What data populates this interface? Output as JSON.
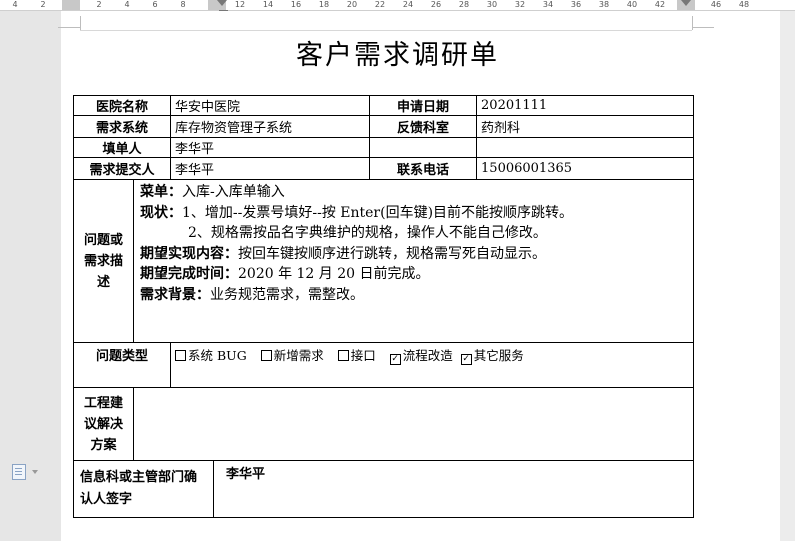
{
  "ruler": {
    "numbers": [
      "4",
      "2",
      "2",
      "4",
      "6",
      "8",
      "12",
      "14",
      "16",
      "18",
      "20",
      "22",
      "24",
      "26",
      "28",
      "30",
      "32",
      "34",
      "36",
      "38",
      "40",
      "42",
      "46",
      "48"
    ]
  },
  "document": {
    "title": "客户需求调研单",
    "rows": {
      "hospital_label": "医院名称",
      "hospital_value": "华安中医院",
      "apply_date_label": "申请日期",
      "apply_date_value": "20201111",
      "system_label": "需求系统",
      "system_value": "库存物资管理子系统",
      "dept_label": "反馈科室",
      "dept_value": "药剂科",
      "filler_label": "填单人",
      "filler_value": "李华平",
      "submitter_label": "需求提交人",
      "submitter_value": "李华平",
      "phone_label": "联系电话",
      "phone_value": "15006001365"
    },
    "problem": {
      "label": "问题或需求描述",
      "menu_label": "菜单：",
      "menu_value": "入库-入库单输入",
      "status_label": "现状：",
      "status_1": "1、增加--发票号填好--按 Enter(回车键)目前不能按顺序跳转。",
      "status_2": "2、规格需按品名字典维护的规格，操作人不能自己修改。",
      "expect_label": "期望实现内容：",
      "expect_value": "按回车键按顺序进行跳转，规格需写死自动显示。",
      "deadline_label": "期望完成时间：",
      "deadline_value": "2020 年 12 月 20 日前完成。",
      "background_label": "需求背景：",
      "background_value": "业务规范需求，需整改。"
    },
    "problem_type": {
      "label": "问题类型",
      "options": [
        {
          "label": "系统 BUG",
          "checked": false
        },
        {
          "label": "新增需求",
          "checked": false
        },
        {
          "label": "接口",
          "checked": false
        },
        {
          "label": "流程改造",
          "checked": true
        },
        {
          "label": "其它服务",
          "checked": true
        }
      ]
    },
    "solution": {
      "label": "工程建议解决方案",
      "value": ""
    },
    "sign": {
      "label": "信息科或主管部门确认人签字",
      "value": "李华平"
    }
  }
}
